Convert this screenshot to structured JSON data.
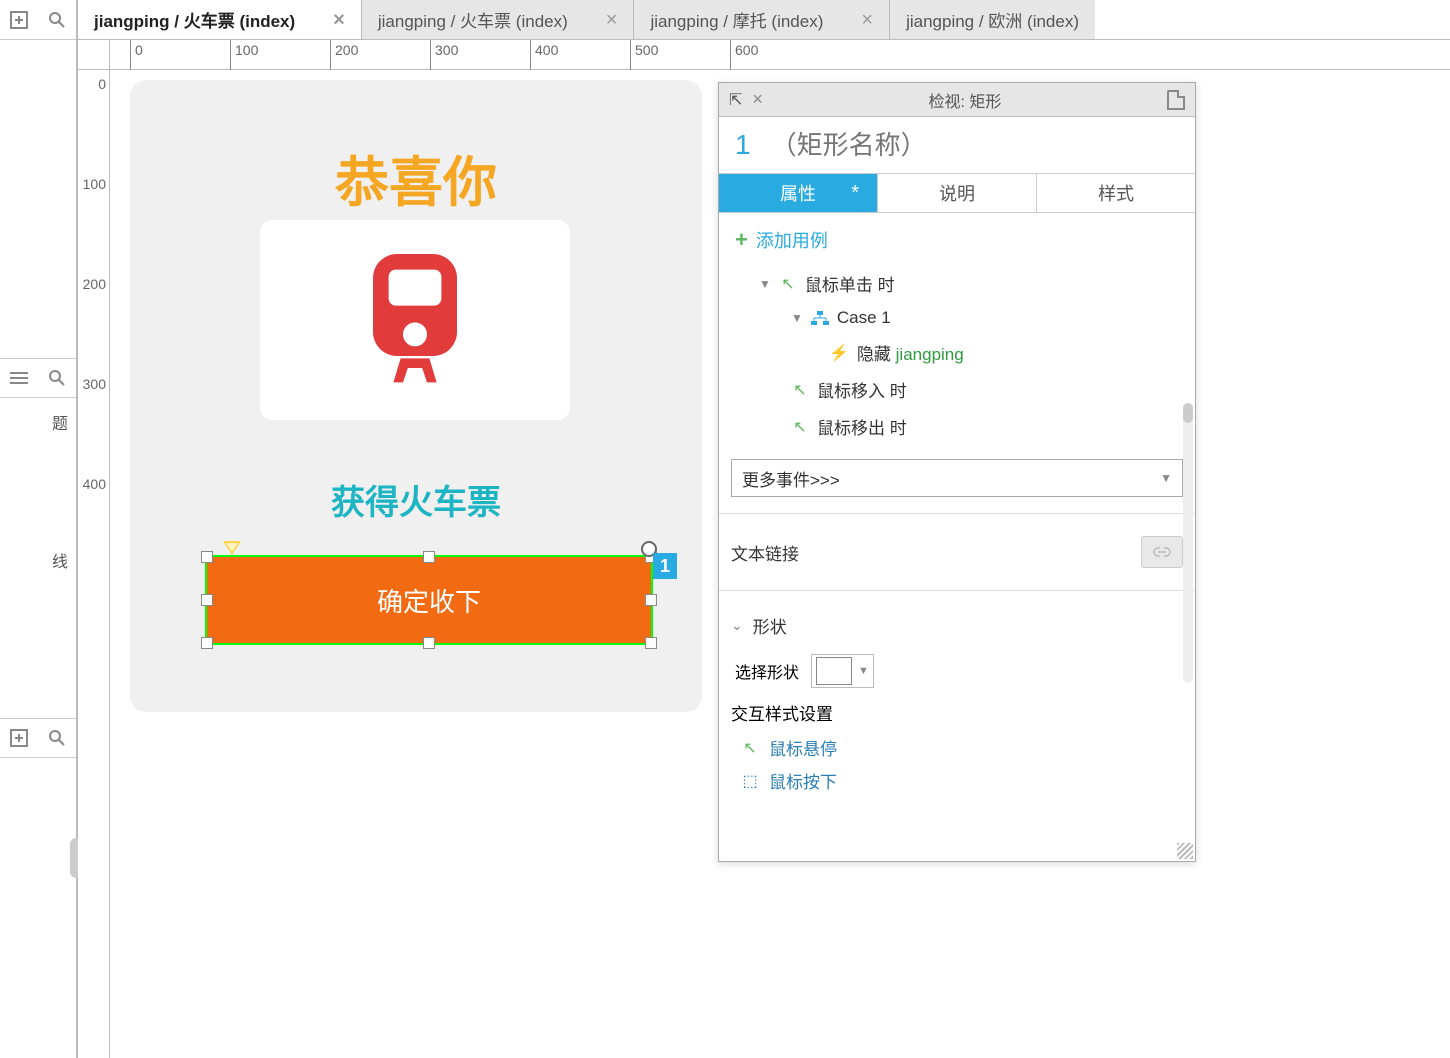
{
  "tabs": [
    {
      "label": "jiangping / 火车票 (index)",
      "active": true
    },
    {
      "label": "jiangping / 火车票 (index)",
      "active": false
    },
    {
      "label": "jiangping / 摩托 (index)",
      "active": false
    },
    {
      "label": "jiangping / 欧洲 (index)",
      "active": false
    }
  ],
  "ruler_h": [
    "0",
    "100",
    "200",
    "300",
    "400",
    "500",
    "600"
  ],
  "ruler_v": [
    "0",
    "100",
    "200",
    "300",
    "400"
  ],
  "canvas": {
    "title": "恭喜你",
    "subtitle": "获得火车票",
    "button_label": "确定收下",
    "badge": "1"
  },
  "inspector": {
    "header_title": "检视: 矩形",
    "name_number": "1",
    "name_placeholder": "（矩形名称）",
    "ptabs": {
      "props": "属性",
      "notes": "说明",
      "style": "样式"
    },
    "add_case": "添加用例",
    "events": {
      "click": "鼠标单击 时",
      "case1": "Case 1",
      "action_prefix": "隐藏 ",
      "action_target": "jiangping",
      "mousein": "鼠标移入 时",
      "mouseout": "鼠标移出 时"
    },
    "more_events": "更多事件>>>",
    "text_link": "文本链接",
    "shape_section": "形状",
    "shape_select_label": "选择形状",
    "istyle_title": "交互样式设置",
    "istyle_hover": "鼠标悬停",
    "istyle_down": "鼠标按下"
  },
  "left_items": {
    "a": "题",
    "b": "线"
  }
}
